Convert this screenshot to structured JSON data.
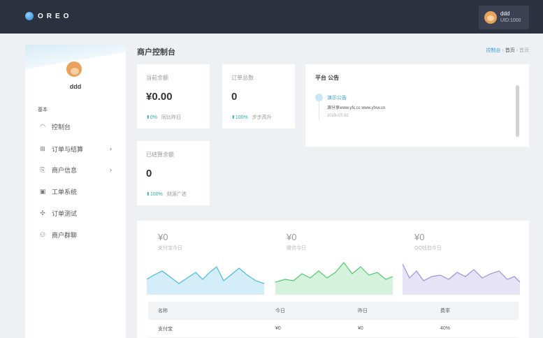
{
  "brand": {
    "name": "OREO",
    "dot_color": "#2a86d8"
  },
  "user": {
    "name": "ddd",
    "uid": "UID:1000"
  },
  "sidebar": {
    "name": "ddd",
    "section": "基本",
    "items": [
      {
        "icon": "dashboard-icon",
        "label": "控制台",
        "has_children": false
      },
      {
        "icon": "grid-icon",
        "label": "订单与结算",
        "has_children": true
      },
      {
        "icon": "document-icon",
        "label": "商户信息",
        "has_children": true
      },
      {
        "icon": "ticket-icon",
        "label": "工单系统",
        "has_children": false
      },
      {
        "icon": "test-icon",
        "label": "订单测试",
        "has_children": false
      },
      {
        "icon": "group-icon",
        "label": "商户群聊",
        "has_children": false
      }
    ],
    "chevron": "›"
  },
  "header": {
    "title": "商户控制台",
    "breadcrumbs": [
      "控制台",
      "首页",
      "首页"
    ],
    "separator": "›"
  },
  "stats": [
    {
      "label": "当前余额",
      "value": "¥0.00",
      "trend_pct": "0%",
      "trend_text": "同比昨日"
    },
    {
      "label": "订单总数",
      "value": "0",
      "trend_pct": "100%",
      "trend_text": "步步高升"
    },
    {
      "label": "已结算余额",
      "value": "0",
      "trend_pct": "100%",
      "trend_text": "财源广进"
    }
  ],
  "trend_arrow": "⬆",
  "notice": {
    "title": "平台 公告",
    "item_title": "演示公告",
    "item_text": "源分享www.yfx.cc www.yfxw.cn",
    "item_date": "2019-07-31"
  },
  "payments": [
    {
      "value": "¥0",
      "label": "支付宝今日",
      "color": "#4ab8e2",
      "fill": "#d4eef9"
    },
    {
      "value": "¥0",
      "label": "微信今日",
      "color": "#52c96b",
      "fill": "#d5f3dc"
    },
    {
      "value": "¥0",
      "label": "QQ钱包今日",
      "color": "#9b91d8",
      "fill": "#e6e3f7"
    }
  ],
  "table": {
    "headers": [
      "名称",
      "今日",
      "昨日",
      "费率"
    ],
    "rows": [
      [
        "支付宝",
        "¥0",
        "¥0",
        "40%"
      ]
    ]
  }
}
